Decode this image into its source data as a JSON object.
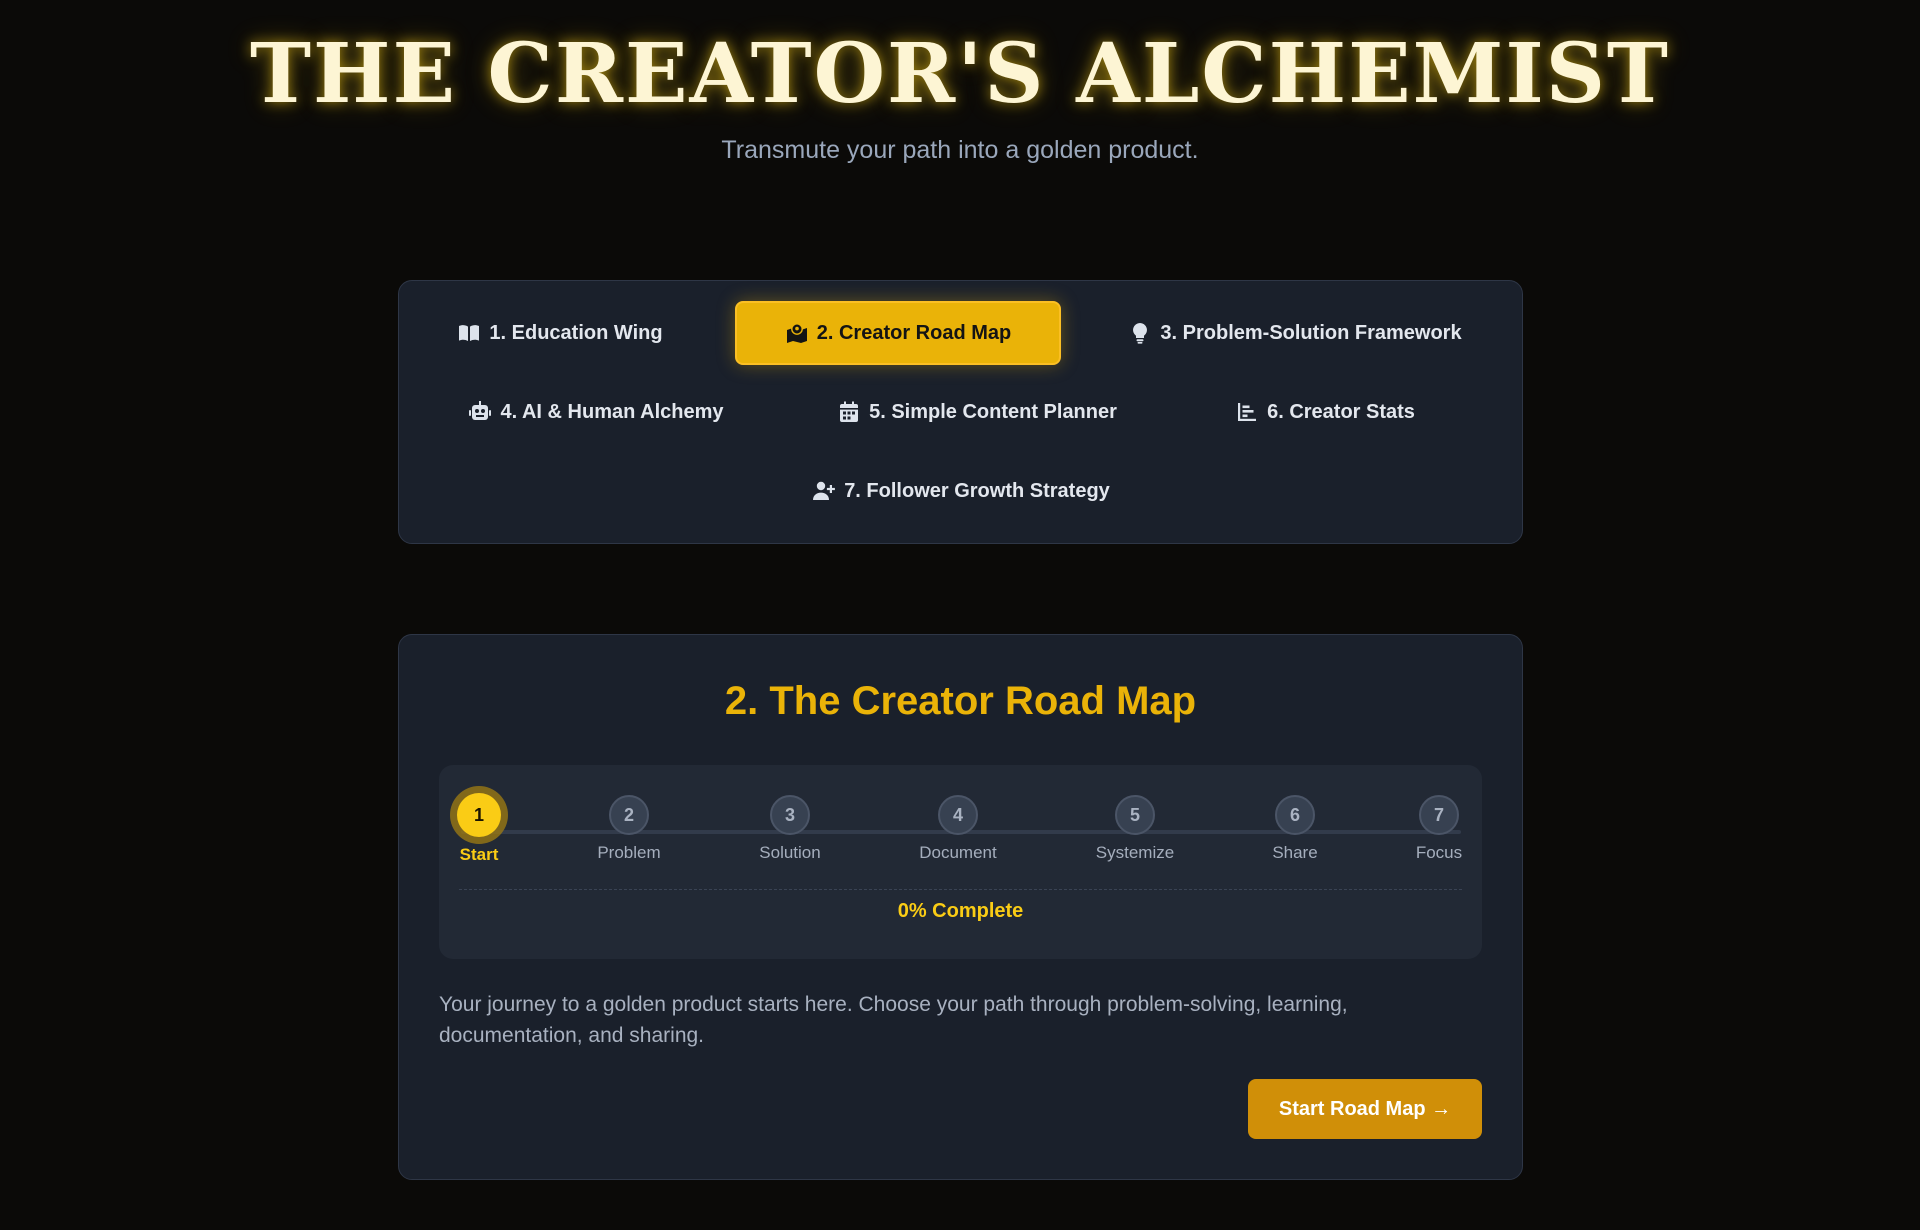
{
  "header": {
    "title": "THE CREATOR'S ALCHEMIST",
    "subtitle": "Transmute your path into a golden product."
  },
  "nav": {
    "tabs": [
      {
        "label": "1. Education Wing",
        "icon": "book-open-icon",
        "active": false
      },
      {
        "label": "2. Creator Road Map",
        "icon": "map-location-icon",
        "active": true
      },
      {
        "label": "3. Problem-Solution Framework",
        "icon": "lightbulb-icon",
        "active": false
      },
      {
        "label": "4. AI & Human Alchemy",
        "icon": "robot-icon",
        "active": false
      },
      {
        "label": "5. Simple Content Planner",
        "icon": "calendar-icon",
        "active": false
      },
      {
        "label": "6. Creator Stats",
        "icon": "bar-chart-icon",
        "active": false
      },
      {
        "label": "7. Follower Growth Strategy",
        "icon": "user-plus-icon",
        "active": false
      }
    ]
  },
  "roadmap": {
    "title": "2. The Creator Road Map",
    "steps": [
      {
        "num": "1",
        "label": "Start",
        "active": true
      },
      {
        "num": "2",
        "label": "Problem",
        "active": false
      },
      {
        "num": "3",
        "label": "Solution",
        "active": false
      },
      {
        "num": "4",
        "label": "Document",
        "active": false
      },
      {
        "num": "5",
        "label": "Systemize",
        "active": false
      },
      {
        "num": "6",
        "label": "Share",
        "active": false
      },
      {
        "num": "7",
        "label": "Focus",
        "active": false
      }
    ],
    "progress_percent": 0,
    "progress_label": "0% Complete",
    "intro": "Your journey to a golden product starts here. Choose your path through problem-solving, learning, documentation, and sharing.",
    "start_button": "Start Road Map →"
  },
  "colors": {
    "background": "#0b0a08",
    "panel": "#1a202b",
    "accent_gold": "#eab308",
    "step_active": "#facc15",
    "button": "#d08f08"
  }
}
